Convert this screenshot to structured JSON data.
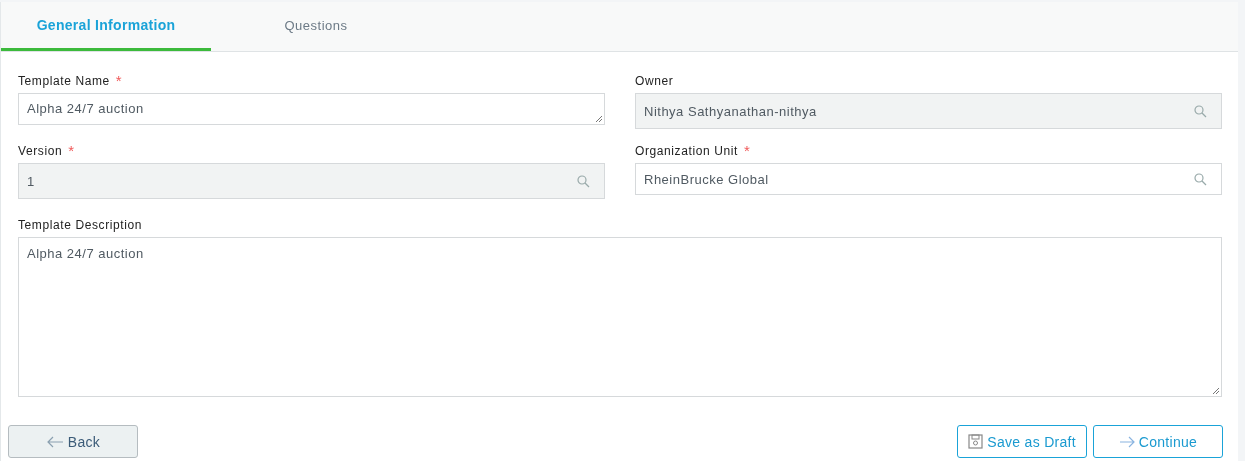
{
  "tabs": [
    {
      "label": "General Information",
      "selected": true
    },
    {
      "label": "Questions",
      "selected": false
    }
  ],
  "fields": [
    {
      "label": "Template Name",
      "required": true,
      "kind": "textarea",
      "value": "Alpha 24/7 auction",
      "disabled": false
    },
    {
      "label": "Owner",
      "required": false,
      "kind": "lookup",
      "value": "Nithya Sathyanathan-nithya",
      "disabled": true
    },
    {
      "label": "Version",
      "required": true,
      "kind": "lookup",
      "value": "1",
      "disabled": true
    },
    {
      "label": "Organization Unit",
      "required": true,
      "kind": "lookup",
      "value": "RheinBrucke Global",
      "disabled": false
    }
  ],
  "description": {
    "label": "Template Description",
    "required": false,
    "value": "Alpha 24/7 auction"
  },
  "required_mark": "*",
  "buttons": {
    "back": "Back",
    "save_draft": "Save as Draft",
    "continue": "Continue"
  }
}
